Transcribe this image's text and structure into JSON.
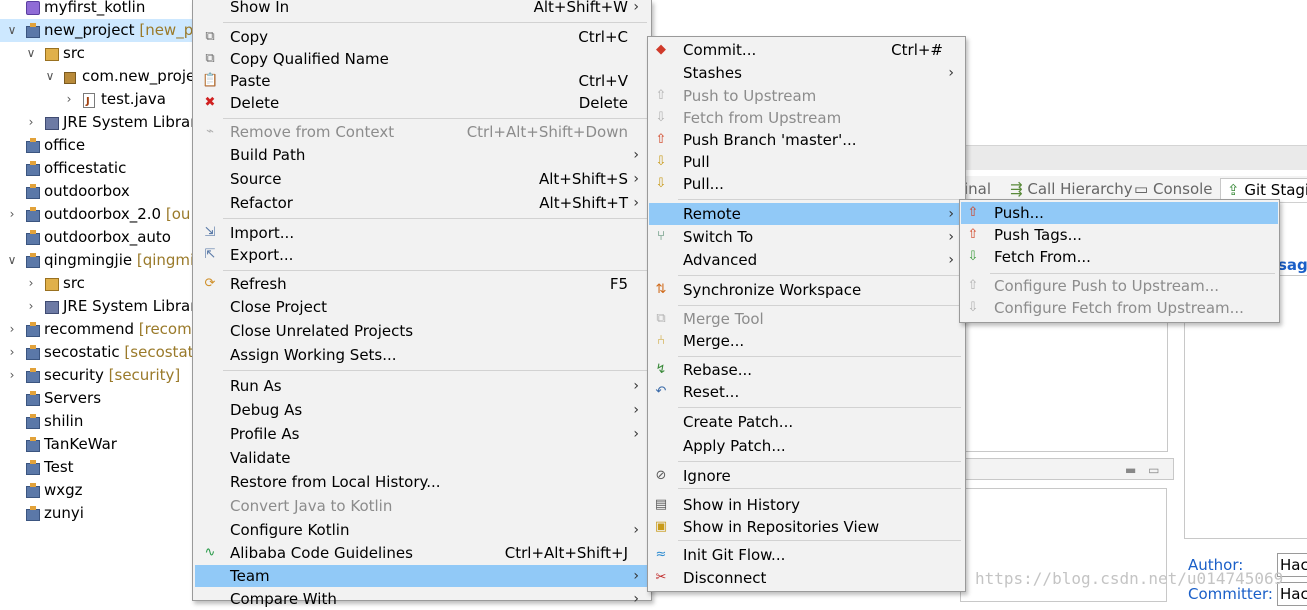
{
  "tree": [
    {
      "label": "myfirst_kotlin",
      "icon": "kotlin-project-icon",
      "twisty": ""
    },
    {
      "label": "new_project",
      "decoration": " [new_p",
      "icon": "git-project-icon",
      "twisty": "∨",
      "selected": true
    },
    {
      "label": "src",
      "icon": "source-folder-icon",
      "twisty": "∨"
    },
    {
      "label": "com.new_proje",
      "icon": "package-icon",
      "twisty": "∨"
    },
    {
      "label": "test.java",
      "icon": "java-file-icon",
      "twisty": "›"
    },
    {
      "label": "JRE System Librar",
      "icon": "library-icon",
      "twisty": "›"
    },
    {
      "label": "office",
      "icon": "project-icon",
      "twisty": ""
    },
    {
      "label": "officestatic",
      "icon": "project-icon",
      "twisty": ""
    },
    {
      "label": "outdoorbox",
      "icon": "project-icon",
      "twisty": ""
    },
    {
      "label": "outdoorbox_2.0",
      "decoration": " [ou",
      "icon": "git-project-icon",
      "twisty": "›"
    },
    {
      "label": "outdoorbox_auto",
      "icon": "project-icon",
      "twisty": ""
    },
    {
      "label": "qingmingjie",
      "decoration": " [qingmi",
      "icon": "git-project-icon",
      "twisty": "∨"
    },
    {
      "label": "src",
      "icon": "source-folder-icon",
      "twisty": "›"
    },
    {
      "label": "JRE System Librar",
      "icon": "library-icon",
      "twisty": "›"
    },
    {
      "label": "recommend",
      "decoration": " [recomm",
      "icon": "git-project-icon",
      "twisty": "›"
    },
    {
      "label": "secostatic",
      "decoration": " [secostati",
      "icon": "git-project-icon",
      "twisty": "›"
    },
    {
      "label": "security",
      "decoration": " [security]",
      "icon": "git-project-icon",
      "twisty": "›"
    },
    {
      "label": "Servers",
      "icon": "project-icon",
      "twisty": ""
    },
    {
      "label": "shilin",
      "icon": "project-icon",
      "twisty": ""
    },
    {
      "label": "TanKeWar",
      "icon": "project-icon",
      "twisty": ""
    },
    {
      "label": "Test",
      "icon": "project-icon",
      "twisty": ""
    },
    {
      "label": "wxgz",
      "icon": "project-icon",
      "twisty": ""
    },
    {
      "label": "zunyi",
      "icon": "project-icon",
      "twisty": ""
    }
  ],
  "main_menu": [
    {
      "label": "Show In",
      "shortcut": "Alt+Shift+W",
      "submenu": true
    },
    {
      "sep": true
    },
    {
      "label": "Copy",
      "shortcut": "Ctrl+C",
      "icon": "copy-icon"
    },
    {
      "label": "Copy Qualified Name",
      "icon": "copy-qualified-icon"
    },
    {
      "label": "Paste",
      "shortcut": "Ctrl+V",
      "icon": "paste-icon"
    },
    {
      "label": "Delete",
      "shortcut": "Delete",
      "icon": "delete-icon"
    },
    {
      "sep": true
    },
    {
      "label": "Remove from Context",
      "shortcut": "Ctrl+Alt+Shift+Down",
      "disabled": true,
      "icon": "remove-context-icon"
    },
    {
      "label": "Build Path",
      "submenu": true
    },
    {
      "label": "Source",
      "shortcut": "Alt+Shift+S",
      "submenu": true
    },
    {
      "label": "Refactor",
      "shortcut": "Alt+Shift+T",
      "submenu": true
    },
    {
      "sep": true
    },
    {
      "label": "Import...",
      "icon": "import-icon"
    },
    {
      "label": "Export...",
      "icon": "export-icon"
    },
    {
      "sep": true
    },
    {
      "label": "Refresh",
      "shortcut": "F5",
      "icon": "refresh-icon"
    },
    {
      "label": "Close Project"
    },
    {
      "label": "Close Unrelated Projects"
    },
    {
      "label": "Assign Working Sets..."
    },
    {
      "sep": true
    },
    {
      "label": "Run As",
      "submenu": true
    },
    {
      "label": "Debug As",
      "submenu": true
    },
    {
      "label": "Profile As",
      "submenu": true
    },
    {
      "label": "Validate"
    },
    {
      "label": "Restore from Local History..."
    },
    {
      "label": "Convert Java to Kotlin",
      "disabled": true
    },
    {
      "label": "Configure Kotlin",
      "submenu": true
    },
    {
      "label": "Alibaba Code Guidelines",
      "shortcut": "Ctrl+Alt+Shift+J",
      "icon": "alibaba-icon"
    },
    {
      "label": "Team",
      "submenu": true,
      "highlight": true
    },
    {
      "label": "Compare With",
      "submenu": true
    }
  ],
  "team_menu": [
    {
      "label": "Commit...",
      "shortcut": "Ctrl+#",
      "icon": "commit-icon"
    },
    {
      "label": "Stashes",
      "submenu": true
    },
    {
      "label": "Push to Upstream",
      "disabled": true,
      "icon": "push-upstream-icon"
    },
    {
      "label": "Fetch from Upstream",
      "disabled": true,
      "icon": "fetch-upstream-icon"
    },
    {
      "label": "Push Branch 'master'...",
      "icon": "push-branch-icon"
    },
    {
      "label": "Pull",
      "icon": "pull-icon"
    },
    {
      "label": "Pull...",
      "icon": "pull-dialog-icon"
    },
    {
      "sep": true
    },
    {
      "label": "Remote",
      "submenu": true,
      "highlight": true
    },
    {
      "label": "Switch To",
      "submenu": true,
      "icon": "switch-branch-icon"
    },
    {
      "label": "Advanced",
      "submenu": true
    },
    {
      "sep": true
    },
    {
      "label": "Synchronize Workspace",
      "icon": "synchronize-icon"
    },
    {
      "sep": true
    },
    {
      "label": "Merge Tool",
      "disabled": true,
      "icon": "merge-tool-icon"
    },
    {
      "label": "Merge...",
      "icon": "merge-icon"
    },
    {
      "sep": true
    },
    {
      "label": "Rebase...",
      "icon": "rebase-icon"
    },
    {
      "label": "Reset...",
      "icon": "reset-icon"
    },
    {
      "sep": true
    },
    {
      "label": "Create Patch..."
    },
    {
      "label": "Apply Patch..."
    },
    {
      "sep": true
    },
    {
      "label": "Ignore",
      "icon": "ignore-icon"
    },
    {
      "sep": true
    },
    {
      "label": "Show in History",
      "icon": "history-icon"
    },
    {
      "label": "Show in Repositories View",
      "icon": "repositories-icon"
    },
    {
      "sep": true
    },
    {
      "label": "Init Git Flow...",
      "icon": "git-flow-icon"
    },
    {
      "label": "Disconnect",
      "icon": "disconnect-icon"
    }
  ],
  "remote_menu": [
    {
      "label": "Push...",
      "icon": "push-icon",
      "highlight": true
    },
    {
      "label": "Push Tags...",
      "icon": "push-tags-icon"
    },
    {
      "label": "Fetch From...",
      "icon": "fetch-icon"
    },
    {
      "sep": true
    },
    {
      "label": "Configure Push to Upstream...",
      "disabled": true,
      "icon": "configure-push-icon"
    },
    {
      "label": "Configure Fetch from Upstream...",
      "disabled": true,
      "icon": "configure-fetch-icon"
    }
  ],
  "background": {
    "tabs": [
      "inal",
      "Call Hierarchy",
      "Console",
      "Git Stagin"
    ],
    "message_label": "sage",
    "author_label": "Author:",
    "author_value": "Hac",
    "committer_label": "Committer:",
    "committer_value": "Hac",
    "watermark": "https://blog.csdn.net/u014745069"
  },
  "colors": {
    "highlight": "#91c9f7",
    "menu_bg": "#f2f2f2",
    "tree_selected": "#cde8ff",
    "decoration": "#9a7a2a",
    "link_label": "#1a5fc8"
  }
}
